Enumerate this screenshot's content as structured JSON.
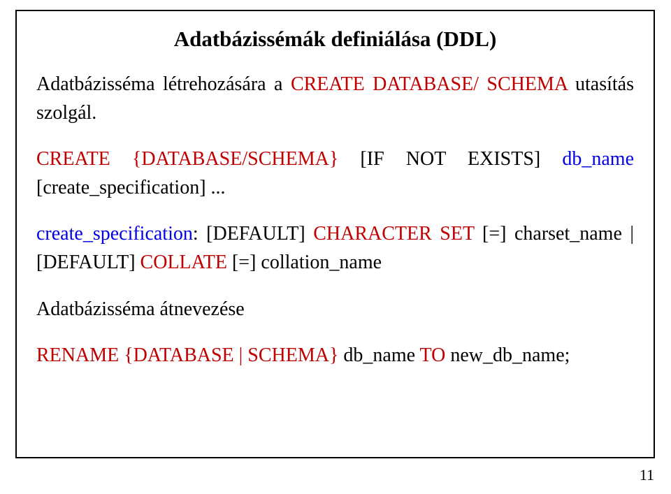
{
  "title": "Adatbázissémák definiálása (DDL)",
  "p1": {
    "a": "Adatbázisséma létrehozására a ",
    "kw": "CREATE DATABASE/ SCHEMA",
    "b": " utasítás szolgál."
  },
  "p2": {
    "a": "CREATE {DATABASE/SCHEMA}",
    "b": " [IF NOT EXISTS] ",
    "c": "db_name ",
    "d": "[create_specification] ..."
  },
  "p3": {
    "a": "create_specification",
    "b": ": [DEFAULT] ",
    "c": "CHARACTER SET",
    "d": " [=] charset_name | [DEFAULT] ",
    "e": "COLLATE",
    "f": " [=] collation_name"
  },
  "p4": "Adatbázisséma átnevezése",
  "p5": {
    "a": "RENAME {DATABASE | SCHEMA}",
    "b": " db_name ",
    "c": "TO",
    "d": " new_db_name;"
  },
  "page_number": "11"
}
